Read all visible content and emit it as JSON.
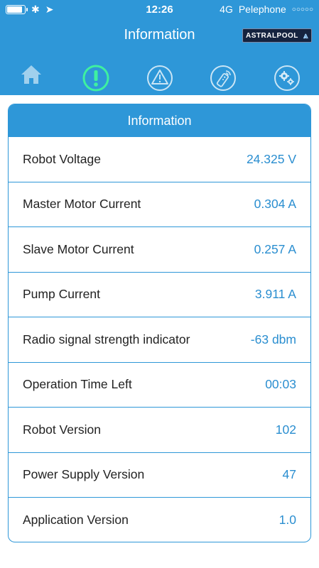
{
  "status_bar": {
    "time": "12:26",
    "network": "4G",
    "carrier": "Pelephone",
    "signal": "○○○○○"
  },
  "header": {
    "title": "Information",
    "brand": "ASTRALPOOL"
  },
  "tabs": [
    {
      "name": "home",
      "icon": "home-icon"
    },
    {
      "name": "information",
      "icon": "info-exclamation-icon",
      "active": true
    },
    {
      "name": "warnings",
      "icon": "warning-icon"
    },
    {
      "name": "remote",
      "icon": "remote-control-icon"
    },
    {
      "name": "settings",
      "icon": "gears-icon"
    }
  ],
  "card": {
    "title": "Information",
    "rows": [
      {
        "label": "Robot Voltage",
        "value": "24.325 V"
      },
      {
        "label": "Master Motor Current",
        "value": "0.304 A"
      },
      {
        "label": "Slave Motor Current",
        "value": "0.257 A"
      },
      {
        "label": "Pump Current",
        "value": "3.911 A"
      },
      {
        "label": "Radio signal strength indicator",
        "value": "-63 dbm"
      },
      {
        "label": "Operation Time Left",
        "value": "00:03"
      },
      {
        "label": "Robot Version",
        "value": "102"
      },
      {
        "label": "Power Supply Version",
        "value": "47"
      },
      {
        "label": "Application Version",
        "value": "1.0"
      }
    ]
  },
  "colors": {
    "primary": "#2e97d8",
    "value_text": "#2a8ed0",
    "active_tab_glow": "#3ff0a0"
  }
}
